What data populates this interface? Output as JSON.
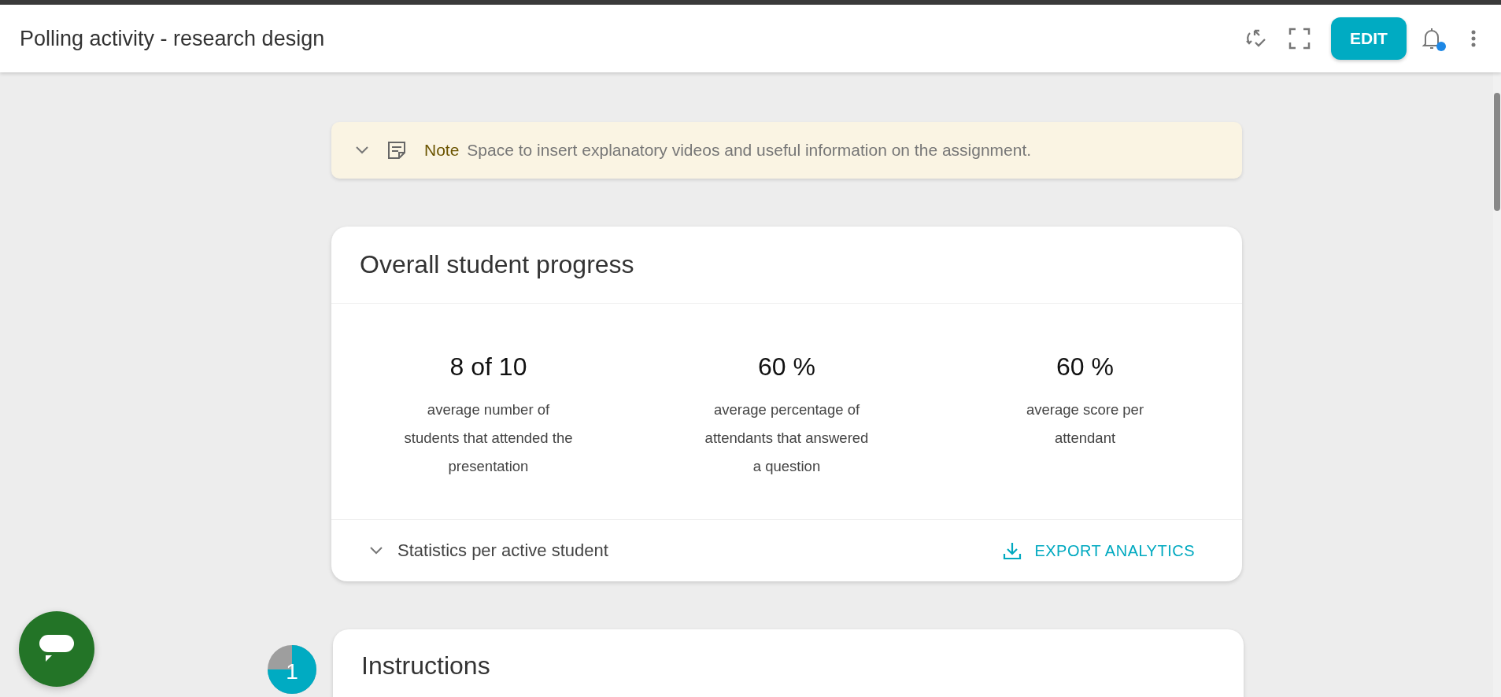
{
  "header": {
    "title": "Polling activity - research design",
    "edit_button": "EDIT",
    "has_notification": true
  },
  "note": {
    "label": "Note",
    "text": "Space to insert explanatory videos and useful information on the assignment."
  },
  "progress_card": {
    "title": "Overall student progress",
    "stats": [
      {
        "value": "8 of 10",
        "caption": "average number of students that attended the presentation"
      },
      {
        "value": "60 %",
        "caption": "average percentage of attendants that answered a question"
      },
      {
        "value": "60 %",
        "caption": "average score per attendant"
      }
    ],
    "statistics_toggle": "Statistics per active student",
    "export_button": "EXPORT ANALYTICS"
  },
  "sections": [
    {
      "number": "1",
      "level": 0.75,
      "title": "Instructions"
    }
  ]
}
